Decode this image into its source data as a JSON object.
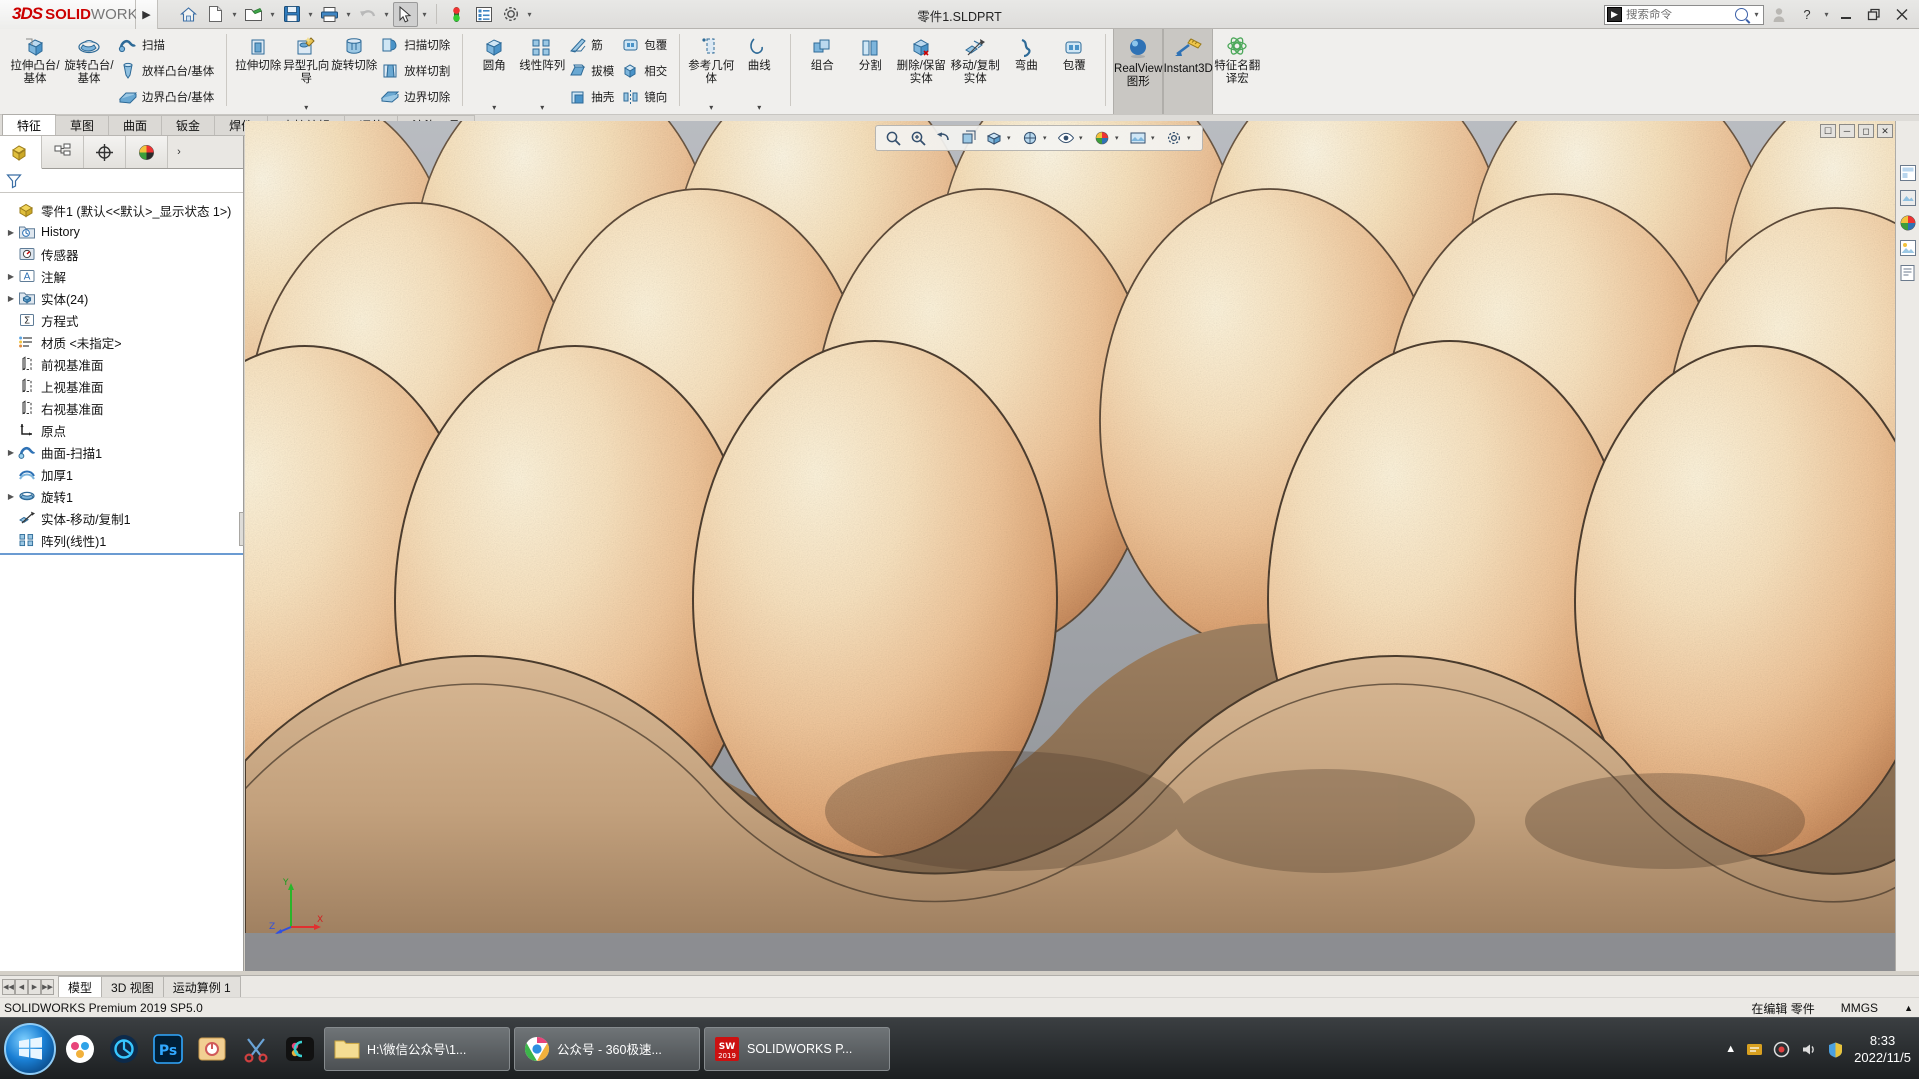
{
  "titlebar": {
    "logo_ds": "3DS",
    "logo_solid": "SOLID",
    "logo_works": "WORKS",
    "document_title": "零件1.SLDPRT",
    "quick_tools": [
      {
        "name": "home-icon",
        "label": "主页"
      },
      {
        "name": "new-document-icon",
        "label": "新建"
      },
      {
        "name": "open-folder-icon",
        "label": "打开"
      },
      {
        "name": "save-icon",
        "label": "保存"
      },
      {
        "name": "print-icon",
        "label": "打印"
      },
      {
        "name": "undo-icon",
        "label": "撤销"
      },
      {
        "name": "select-cursor-icon",
        "label": "选择"
      },
      {
        "name": "rebuild-icon",
        "label": "重建模型"
      },
      {
        "name": "options-list-icon",
        "label": "选项列表"
      },
      {
        "name": "gear-icon",
        "label": "选项"
      }
    ],
    "search": {
      "placeholder": "搜索命令",
      "value": ""
    },
    "window_buttons": [
      {
        "name": "user-account-icon",
        "glyph": "☺"
      },
      {
        "name": "help-icon",
        "glyph": "?"
      },
      {
        "name": "minimize-icon",
        "glyph": "—"
      },
      {
        "name": "restore-icon",
        "glyph": "❐"
      },
      {
        "name": "close-icon",
        "glyph": "✕"
      }
    ]
  },
  "ribbon": {
    "groups": [
      {
        "big": [
          {
            "label": "拉伸凸台/基体",
            "icon": "extrude-boss-icon"
          },
          {
            "label": "旋转凸台/基体",
            "icon": "revolve-boss-icon"
          }
        ],
        "small": [
          {
            "label": "扫描",
            "icon": "sweep-icon"
          },
          {
            "label": "放样凸台/基体",
            "icon": "loft-boss-icon"
          },
          {
            "label": "边界凸台/基体",
            "icon": "boundary-boss-icon"
          }
        ]
      },
      {
        "big": [
          {
            "label": "拉伸切除",
            "icon": "extrude-cut-icon"
          },
          {
            "label": "异型孔向导",
            "icon": "hole-wizard-icon",
            "dropdown": true
          },
          {
            "label": "旋转切除",
            "icon": "revolve-cut-icon"
          }
        ],
        "small": [
          {
            "label": "扫描切除",
            "icon": "sweep-cut-icon"
          },
          {
            "label": "放样切割",
            "icon": "loft-cut-icon"
          },
          {
            "label": "边界切除",
            "icon": "boundary-cut-icon"
          }
        ]
      },
      {
        "big": [
          {
            "label": "圆角",
            "icon": "fillet-icon",
            "dropdown": true
          },
          {
            "label": "线性阵列",
            "icon": "linear-pattern-icon",
            "dropdown": true
          }
        ],
        "small": [
          {
            "label": "筋",
            "icon": "rib-icon"
          },
          {
            "label": "拔模",
            "icon": "draft-icon"
          },
          {
            "label": "抽壳",
            "icon": "shell-icon"
          }
        ],
        "small2": [
          {
            "label": "包覆",
            "icon": "wrap-icon"
          },
          {
            "label": "相交",
            "icon": "intersect-icon"
          },
          {
            "label": "镜向",
            "icon": "mirror-icon"
          }
        ]
      },
      {
        "big": [
          {
            "label": "参考几何体",
            "icon": "reference-geometry-icon",
            "dropdown": true
          },
          {
            "label": "曲线",
            "icon": "curves-icon",
            "dropdown": true
          }
        ]
      },
      {
        "big": [
          {
            "label": "组合",
            "icon": "combine-icon"
          },
          {
            "label": "分割",
            "icon": "split-icon"
          },
          {
            "label": "删除/保留实体",
            "icon": "delete-keep-body-icon"
          },
          {
            "label": "移动/复制实体",
            "icon": "move-copy-body-icon"
          },
          {
            "label": "弯曲",
            "icon": "flex-icon"
          },
          {
            "label": "包覆",
            "icon": "wrap2-icon"
          }
        ]
      },
      {
        "toggles": [
          {
            "label": "RealView 图形",
            "icon": "realview-sphere-icon",
            "active": true
          },
          {
            "label": "Instant3D",
            "icon": "instant3d-icon",
            "active": true
          }
        ],
        "big": [
          {
            "label": "特征名翻译宏",
            "icon": "macro-icon"
          }
        ]
      }
    ],
    "tabs": [
      {
        "label": "特征",
        "active": true
      },
      {
        "label": "草图",
        "active": false
      },
      {
        "label": "曲面",
        "active": false
      },
      {
        "label": "钣金",
        "active": false
      },
      {
        "label": "焊件",
        "active": false
      },
      {
        "label": "直接编辑",
        "active": false
      },
      {
        "label": "评估",
        "active": false
      },
      {
        "label": "渲染工具",
        "active": false
      }
    ]
  },
  "left_panel": {
    "tabs": [
      {
        "name": "feature-manager-tab",
        "label": "FeatureManager 设计树",
        "active": true
      },
      {
        "name": "property-manager-tab",
        "label": "PropertyManager",
        "active": false
      },
      {
        "name": "configuration-manager-tab",
        "label": "ConfigurationManager",
        "active": false
      },
      {
        "name": "display-manager-tab",
        "label": "DisplayManager",
        "active": false
      },
      {
        "name": "more-tabs",
        "label": "›",
        "active": false
      }
    ],
    "filter_placeholder": "",
    "filter_value": "",
    "tree": [
      {
        "label": "零件1  (默认<<默认>_显示状态 1>)",
        "icon": "part-icon",
        "expandable": false,
        "indent": 0,
        "root": true
      },
      {
        "label": "History",
        "icon": "history-folder-icon",
        "expandable": true,
        "indent": 1
      },
      {
        "label": "传感器",
        "icon": "sensors-icon",
        "expandable": false,
        "indent": 1
      },
      {
        "label": "注解",
        "icon": "annotations-icon",
        "expandable": true,
        "indent": 1
      },
      {
        "label": "实体(24)",
        "icon": "solid-bodies-icon",
        "expandable": true,
        "indent": 1
      },
      {
        "label": "方程式",
        "icon": "equations-icon",
        "expandable": false,
        "indent": 1
      },
      {
        "label": "材质 <未指定>",
        "icon": "material-icon",
        "expandable": false,
        "indent": 1
      },
      {
        "label": "前视基准面",
        "icon": "plane-icon",
        "expandable": false,
        "indent": 1
      },
      {
        "label": "上视基准面",
        "icon": "plane-icon",
        "expandable": false,
        "indent": 1
      },
      {
        "label": "右视基准面",
        "icon": "plane-icon",
        "expandable": false,
        "indent": 1
      },
      {
        "label": "原点",
        "icon": "origin-icon",
        "expandable": false,
        "indent": 1
      },
      {
        "label": "曲面-扫描1",
        "icon": "surface-sweep-icon",
        "expandable": true,
        "indent": 1
      },
      {
        "label": "加厚1",
        "icon": "thicken-icon",
        "expandable": false,
        "indent": 1
      },
      {
        "label": "旋转1",
        "icon": "revolve-feature-icon",
        "expandable": true,
        "indent": 1
      },
      {
        "label": "实体-移动/复制1",
        "icon": "body-move-copy-icon",
        "expandable": false,
        "indent": 1
      },
      {
        "label": "阵列(线性)1",
        "icon": "linear-pattern-feature-icon",
        "expandable": false,
        "indent": 1
      }
    ]
  },
  "graphics": {
    "heads_up_tools": [
      {
        "name": "zoom-to-fit-icon"
      },
      {
        "name": "zoom-to-area-icon"
      },
      {
        "name": "previous-view-icon"
      },
      {
        "name": "section-view-icon"
      },
      {
        "name": "view-orientation-icon"
      },
      {
        "name": "display-style-icon"
      },
      {
        "name": "hide-show-items-icon"
      },
      {
        "name": "edit-appearance-icon"
      },
      {
        "name": "apply-scene-icon"
      },
      {
        "name": "view-settings-icon"
      }
    ],
    "right_toolbar": [
      {
        "name": "view-palette-icon"
      },
      {
        "name": "appearances-icon"
      },
      {
        "name": "scenes-icon"
      },
      {
        "name": "decals-icon"
      },
      {
        "name": "custom-properties-icon"
      }
    ],
    "triad_labels": {
      "x": "X",
      "y": "Y",
      "z": "Z"
    },
    "scene_description": "鸡蛋蛋托三维渲染模型"
  },
  "bottom": {
    "tabs": [
      {
        "label": "模型",
        "active": true
      },
      {
        "label": "3D 视图",
        "active": false
      },
      {
        "label": "运动算例 1",
        "active": false
      }
    ],
    "status_left": "SOLIDWORKS Premium 2019 SP5.0",
    "status_right": [
      {
        "name": "editing-status",
        "label": "在编辑 零件"
      },
      {
        "name": "units-status",
        "label": "MMGS"
      },
      {
        "name": "units-dropdown",
        "label": "▲"
      }
    ]
  },
  "taskbar": {
    "pinned": [
      {
        "name": "start-orb",
        "label": "开始"
      },
      {
        "name": "app-icon-1",
        "label": "应用1"
      },
      {
        "name": "app-icon-2",
        "label": "应用2"
      },
      {
        "name": "photoshop-icon",
        "label": "Ps"
      },
      {
        "name": "app-icon-4",
        "label": "应用4"
      },
      {
        "name": "snip-tool-icon",
        "label": "截图工具"
      },
      {
        "name": "app-icon-6",
        "label": "应用6"
      }
    ],
    "windows": [
      {
        "name": "explorer-window",
        "label": "H:\\微信公众号\\1...",
        "icon": "folder-icon"
      },
      {
        "name": "browser-window",
        "label": "公众号 - 360极速...",
        "icon": "browser-icon"
      },
      {
        "name": "solidworks-window",
        "label": "SOLIDWORKS P...",
        "icon": "solidworks-icon"
      }
    ],
    "tray": {
      "icons": [
        "tray-arrow-icon",
        "tray-app-icon",
        "tray-network-icon",
        "tray-volume-icon",
        "tray-shield-icon"
      ],
      "time": "8:33",
      "date": "2022/11/5"
    }
  }
}
